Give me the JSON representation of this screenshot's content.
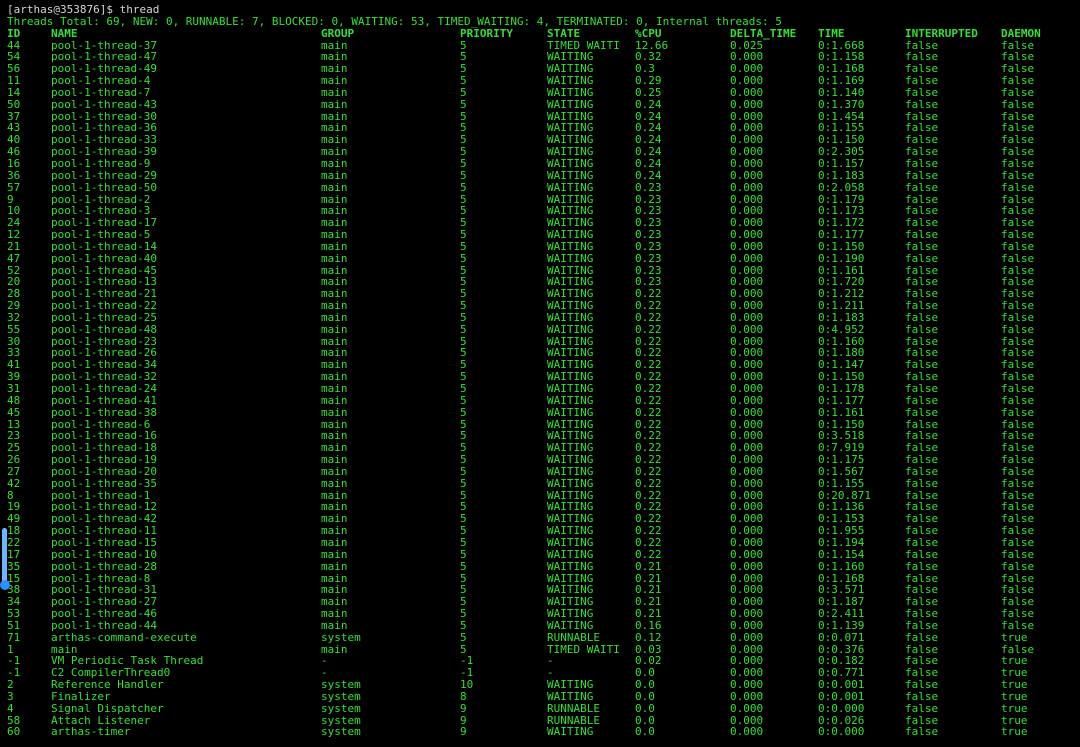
{
  "prompt": "[arthas@353876]$ thread",
  "summary": "Threads Total: 69, NEW: 0, RUNNABLE: 7, BLOCKED: 0, WAITING: 53, TIMED_WAITING: 4, TERMINATED: 0, Internal threads: 5",
  "columns": [
    "ID",
    "NAME",
    "GROUP",
    "PRIORITY",
    "STATE",
    "%CPU",
    "DELTA_TIME",
    "TIME",
    "INTERRUPTED",
    "DAEMON"
  ],
  "rows": [
    [
      "44",
      "pool-1-thread-37",
      "main",
      "5",
      "TIMED_WAITI",
      "12.66",
      "0.025",
      "0:1.668",
      "false",
      "false"
    ],
    [
      "54",
      "pool-1-thread-47",
      "main",
      "5",
      "WAITING",
      "0.32",
      "0.000",
      "0:1.158",
      "false",
      "false"
    ],
    [
      "56",
      "pool-1-thread-49",
      "main",
      "5",
      "WAITING",
      "0.3",
      "0.000",
      "0:1.168",
      "false",
      "false"
    ],
    [
      "11",
      "pool-1-thread-4",
      "main",
      "5",
      "WAITING",
      "0.29",
      "0.000",
      "0:1.169",
      "false",
      "false"
    ],
    [
      "14",
      "pool-1-thread-7",
      "main",
      "5",
      "WAITING",
      "0.25",
      "0.000",
      "0:1.140",
      "false",
      "false"
    ],
    [
      "50",
      "pool-1-thread-43",
      "main",
      "5",
      "WAITING",
      "0.24",
      "0.000",
      "0:1.370",
      "false",
      "false"
    ],
    [
      "37",
      "pool-1-thread-30",
      "main",
      "5",
      "WAITING",
      "0.24",
      "0.000",
      "0:1.454",
      "false",
      "false"
    ],
    [
      "43",
      "pool-1-thread-36",
      "main",
      "5",
      "WAITING",
      "0.24",
      "0.000",
      "0:1.155",
      "false",
      "false"
    ],
    [
      "40",
      "pool-1-thread-33",
      "main",
      "5",
      "WAITING",
      "0.24",
      "0.000",
      "0:1.150",
      "false",
      "false"
    ],
    [
      "46",
      "pool-1-thread-39",
      "main",
      "5",
      "WAITING",
      "0.24",
      "0.000",
      "0:2.305",
      "false",
      "false"
    ],
    [
      "16",
      "pool-1-thread-9",
      "main",
      "5",
      "WAITING",
      "0.24",
      "0.000",
      "0:1.157",
      "false",
      "false"
    ],
    [
      "36",
      "pool-1-thread-29",
      "main",
      "5",
      "WAITING",
      "0.24",
      "0.000",
      "0:1.183",
      "false",
      "false"
    ],
    [
      "57",
      "pool-1-thread-50",
      "main",
      "5",
      "WAITING",
      "0.23",
      "0.000",
      "0:2.058",
      "false",
      "false"
    ],
    [
      "9",
      "pool-1-thread-2",
      "main",
      "5",
      "WAITING",
      "0.23",
      "0.000",
      "0:1.179",
      "false",
      "false"
    ],
    [
      "10",
      "pool-1-thread-3",
      "main",
      "5",
      "WAITING",
      "0.23",
      "0.000",
      "0:1.173",
      "false",
      "false"
    ],
    [
      "24",
      "pool-1-thread-17",
      "main",
      "5",
      "WAITING",
      "0.23",
      "0.000",
      "0:1.172",
      "false",
      "false"
    ],
    [
      "12",
      "pool-1-thread-5",
      "main",
      "5",
      "WAITING",
      "0.23",
      "0.000",
      "0:1.177",
      "false",
      "false"
    ],
    [
      "21",
      "pool-1-thread-14",
      "main",
      "5",
      "WAITING",
      "0.23",
      "0.000",
      "0:1.150",
      "false",
      "false"
    ],
    [
      "47",
      "pool-1-thread-40",
      "main",
      "5",
      "WAITING",
      "0.23",
      "0.000",
      "0:1.190",
      "false",
      "false"
    ],
    [
      "52",
      "pool-1-thread-45",
      "main",
      "5",
      "WAITING",
      "0.23",
      "0.000",
      "0:1.161",
      "false",
      "false"
    ],
    [
      "20",
      "pool-1-thread-13",
      "main",
      "5",
      "WAITING",
      "0.23",
      "0.000",
      "0:1.720",
      "false",
      "false"
    ],
    [
      "28",
      "pool-1-thread-21",
      "main",
      "5",
      "WAITING",
      "0.22",
      "0.000",
      "0:1.212",
      "false",
      "false"
    ],
    [
      "29",
      "pool-1-thread-22",
      "main",
      "5",
      "WAITING",
      "0.22",
      "0.000",
      "0:1.211",
      "false",
      "false"
    ],
    [
      "32",
      "pool-1-thread-25",
      "main",
      "5",
      "WAITING",
      "0.22",
      "0.000",
      "0:1.183",
      "false",
      "false"
    ],
    [
      "55",
      "pool-1-thread-48",
      "main",
      "5",
      "WAITING",
      "0.22",
      "0.000",
      "0:4.952",
      "false",
      "false"
    ],
    [
      "30",
      "pool-1-thread-23",
      "main",
      "5",
      "WAITING",
      "0.22",
      "0.000",
      "0:1.160",
      "false",
      "false"
    ],
    [
      "33",
      "pool-1-thread-26",
      "main",
      "5",
      "WAITING",
      "0.22",
      "0.000",
      "0:1.180",
      "false",
      "false"
    ],
    [
      "41",
      "pool-1-thread-34",
      "main",
      "5",
      "WAITING",
      "0.22",
      "0.000",
      "0:1.147",
      "false",
      "false"
    ],
    [
      "39",
      "pool-1-thread-32",
      "main",
      "5",
      "WAITING",
      "0.22",
      "0.000",
      "0:1.150",
      "false",
      "false"
    ],
    [
      "31",
      "pool-1-thread-24",
      "main",
      "5",
      "WAITING",
      "0.22",
      "0.000",
      "0:1.178",
      "false",
      "false"
    ],
    [
      "48",
      "pool-1-thread-41",
      "main",
      "5",
      "WAITING",
      "0.22",
      "0.000",
      "0:1.177",
      "false",
      "false"
    ],
    [
      "45",
      "pool-1-thread-38",
      "main",
      "5",
      "WAITING",
      "0.22",
      "0.000",
      "0:1.161",
      "false",
      "false"
    ],
    [
      "13",
      "pool-1-thread-6",
      "main",
      "5",
      "WAITING",
      "0.22",
      "0.000",
      "0:1.150",
      "false",
      "false"
    ],
    [
      "23",
      "pool-1-thread-16",
      "main",
      "5",
      "WAITING",
      "0.22",
      "0.000",
      "0:3.518",
      "false",
      "false"
    ],
    [
      "25",
      "pool-1-thread-18",
      "main",
      "5",
      "WAITING",
      "0.22",
      "0.000",
      "0:7.919",
      "false",
      "false"
    ],
    [
      "26",
      "pool-1-thread-19",
      "main",
      "5",
      "WAITING",
      "0.22",
      "0.000",
      "0:1.175",
      "false",
      "false"
    ],
    [
      "27",
      "pool-1-thread-20",
      "main",
      "5",
      "WAITING",
      "0.22",
      "0.000",
      "0:1.567",
      "false",
      "false"
    ],
    [
      "42",
      "pool-1-thread-35",
      "main",
      "5",
      "WAITING",
      "0.22",
      "0.000",
      "0:1.155",
      "false",
      "false"
    ],
    [
      "8",
      "pool-1-thread-1",
      "main",
      "5",
      "WAITING",
      "0.22",
      "0.000",
      "0:20.871",
      "false",
      "false"
    ],
    [
      "19",
      "pool-1-thread-12",
      "main",
      "5",
      "WAITING",
      "0.22",
      "0.000",
      "0:1.136",
      "false",
      "false"
    ],
    [
      "49",
      "pool-1-thread-42",
      "main",
      "5",
      "WAITING",
      "0.22",
      "0.000",
      "0:1.153",
      "false",
      "false"
    ],
    [
      "18",
      "pool-1-thread-11",
      "main",
      "5",
      "WAITING",
      "0.22",
      "0.000",
      "0:1.955",
      "false",
      "false"
    ],
    [
      "22",
      "pool-1-thread-15",
      "main",
      "5",
      "WAITING",
      "0.22",
      "0.000",
      "0:1.194",
      "false",
      "false"
    ],
    [
      "17",
      "pool-1-thread-10",
      "main",
      "5",
      "WAITING",
      "0.22",
      "0.000",
      "0:1.154",
      "false",
      "false"
    ],
    [
      "35",
      "pool-1-thread-28",
      "main",
      "5",
      "WAITING",
      "0.21",
      "0.000",
      "0:1.160",
      "false",
      "false"
    ],
    [
      "15",
      "pool-1-thread-8",
      "main",
      "5",
      "WAITING",
      "0.21",
      "0.000",
      "0:1.168",
      "false",
      "false"
    ],
    [
      "38",
      "pool-1-thread-31",
      "main",
      "5",
      "WAITING",
      "0.21",
      "0.000",
      "0:3.571",
      "false",
      "false"
    ],
    [
      "34",
      "pool-1-thread-27",
      "main",
      "5",
      "WAITING",
      "0.21",
      "0.000",
      "0:1.187",
      "false",
      "false"
    ],
    [
      "53",
      "pool-1-thread-46",
      "main",
      "5",
      "WAITING",
      "0.21",
      "0.000",
      "0:2.411",
      "false",
      "false"
    ],
    [
      "51",
      "pool-1-thread-44",
      "main",
      "5",
      "WAITING",
      "0.16",
      "0.000",
      "0:1.139",
      "false",
      "false"
    ],
    [
      "71",
      "arthas-command-execute",
      "system",
      "5",
      "RUNNABLE",
      "0.12",
      "0.000",
      "0:0.071",
      "false",
      "true"
    ],
    [
      "1",
      "main",
      "main",
      "5",
      "TIMED_WAITI",
      "0.03",
      "0.000",
      "0:0.376",
      "false",
      "false"
    ],
    [
      "-1",
      "VM Periodic Task Thread",
      "-",
      "-1",
      "-",
      "0.02",
      "0.000",
      "0:0.182",
      "false",
      "true"
    ],
    [
      "-1",
      "C2 CompilerThread0",
      "-",
      "-1",
      "-",
      "0.0",
      "0.000",
      "0:0.771",
      "false",
      "true"
    ],
    [
      "2",
      "Reference Handler",
      "system",
      "10",
      "WAITING",
      "0.0",
      "0.000",
      "0:0.001",
      "false",
      "true"
    ],
    [
      "3",
      "Finalizer",
      "system",
      "8",
      "WAITING",
      "0.0",
      "0.000",
      "0:0.001",
      "false",
      "true"
    ],
    [
      "4",
      "Signal Dispatcher",
      "system",
      "9",
      "RUNNABLE",
      "0.0",
      "0.000",
      "0:0.000",
      "false",
      "true"
    ],
    [
      "58",
      "Attach Listener",
      "system",
      "9",
      "RUNNABLE",
      "0.0",
      "0.000",
      "0:0.026",
      "false",
      "true"
    ],
    [
      "60",
      "arthas-timer",
      "system",
      "9",
      "WAITING",
      "0.0",
      "0.000",
      "0:0.000",
      "false",
      "true"
    ]
  ],
  "colors": {
    "background": "#000000",
    "text": "#35e035",
    "prompt": "#d6d6d6",
    "scroll_thumb": "#6fb4ff"
  }
}
